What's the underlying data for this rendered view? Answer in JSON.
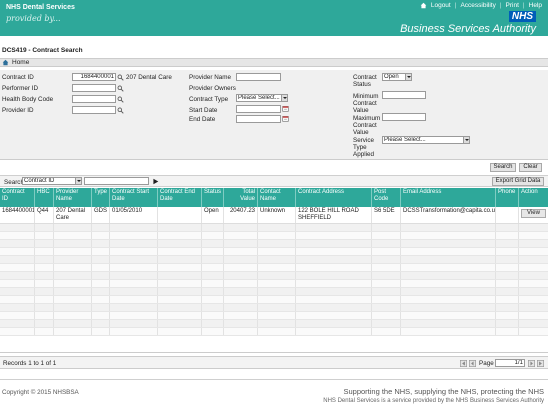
{
  "header": {
    "brand": "NHS Dental Services",
    "brand_sub": "provided by...",
    "links": [
      "Logout",
      "Accessibility",
      "Print",
      "Help"
    ],
    "nhs_logo": "NHS",
    "authority": "Business Services Authority"
  },
  "page_title": "DCS419 - Contract Search",
  "breadcrumb": {
    "home": "Home"
  },
  "form": {
    "contract_id": {
      "label": "Contract ID",
      "value": "1684400001",
      "name": "207 Dental Care"
    },
    "performer_id": {
      "label": "Performer ID",
      "value": ""
    },
    "health_body_code": {
      "label": "Health Body Code",
      "value": ""
    },
    "provider_id": {
      "label": "Provider ID",
      "value": ""
    },
    "provider_name": {
      "label": "Provider Name",
      "value": ""
    },
    "provider_owners": {
      "label": "Provider Owners"
    },
    "contract_type": {
      "label": "Contract Type",
      "value": "Please Select..."
    },
    "start_date": {
      "label": "Start Date",
      "value": ""
    },
    "end_date": {
      "label": "End Date",
      "value": ""
    },
    "contract_status": {
      "label": "Contract Status",
      "value": "Open"
    },
    "min_contract_value": {
      "label": "Minimum Contract Value",
      "value": ""
    },
    "max_contract_value": {
      "label": "Maximum Contract Value",
      "value": ""
    },
    "service_type": {
      "label": "Service Type Applied",
      "value": "Please Select..."
    },
    "search_button": "Search",
    "clear_button": "Clear"
  },
  "grid_toolbar": {
    "search_label": "Search",
    "search_field": "Contract ID",
    "search_value": "",
    "export_button": "Export Grid Data"
  },
  "grid": {
    "columns": [
      "Contract ID",
      "HBC",
      "Provider Name",
      "Type",
      "Contract Start Date",
      "Contract End Date",
      "Status",
      "Total Value",
      "Contact Name",
      "Contract Address",
      "Post Code",
      "Email Address",
      "Phone",
      "Action"
    ],
    "rows": [
      {
        "contract_id": "1684400001",
        "hbc": "Q44",
        "provider_name": "207 Dental Care",
        "type": "GDS",
        "start_date": "01/05/2010",
        "end_date": "",
        "status": "Open",
        "total_value": "20407.23",
        "contact_name": "Unknown",
        "address": "122 BOLE HILL ROAD SHEFFIELD",
        "post_code": "S6 5DE",
        "email": "DCSSTransformation@capita.co.uk",
        "phone": "",
        "action": "View"
      }
    ]
  },
  "grid_footer": {
    "records": "Records 1 to 1 of 1",
    "page_label": "Page",
    "page_value": "1/1"
  },
  "footer": {
    "copyright": "Copyright © 2015 NHSBSA",
    "tagline": "Supporting the NHS, supplying the NHS, protecting the NHS",
    "service_note": "NHS Dental Services is a service provided by the NHS Business Services Authority"
  }
}
